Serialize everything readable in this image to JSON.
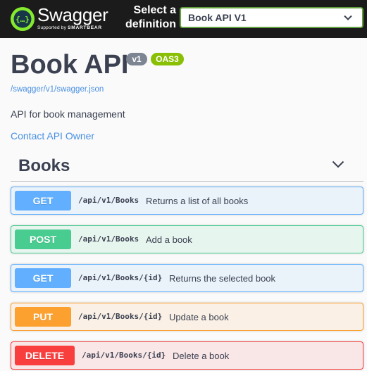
{
  "topbar": {
    "brand": "Swagger",
    "brand_sub_prefix": "Supported by",
    "brand_sub_company": "SMARTBEAR",
    "definition_label": "Select a definition",
    "definition_selected": "Book API V1",
    "colors": {
      "background": "#1b1b1b",
      "logo": "#85ea2d",
      "select_border": "#62a03f"
    }
  },
  "info": {
    "title": "Book API",
    "version_badge": "v1",
    "oas_badge": "OAS3",
    "spec_link": "/swagger/v1/swagger.json",
    "description": "API for book management",
    "contact": "Contact API Owner"
  },
  "tag": {
    "name": "Books",
    "icon": "chevron-down-icon"
  },
  "operations": [
    {
      "method": "GET",
      "path": "/api/v1/Books",
      "summary": "Returns a list of all books",
      "color": "#61affe"
    },
    {
      "method": "POST",
      "path": "/api/v1/Books",
      "summary": "Add a book",
      "color": "#49cc90"
    },
    {
      "method": "GET",
      "path": "/api/v1/Books/{id}",
      "summary": "Returns the selected book",
      "color": "#61affe"
    },
    {
      "method": "PUT",
      "path": "/api/v1/Books/{id}",
      "summary": "Update a book",
      "color": "#fca130"
    },
    {
      "method": "DELETE",
      "path": "/api/v1/Books/{id}",
      "summary": "Delete a book",
      "color": "#f93e3e"
    }
  ]
}
